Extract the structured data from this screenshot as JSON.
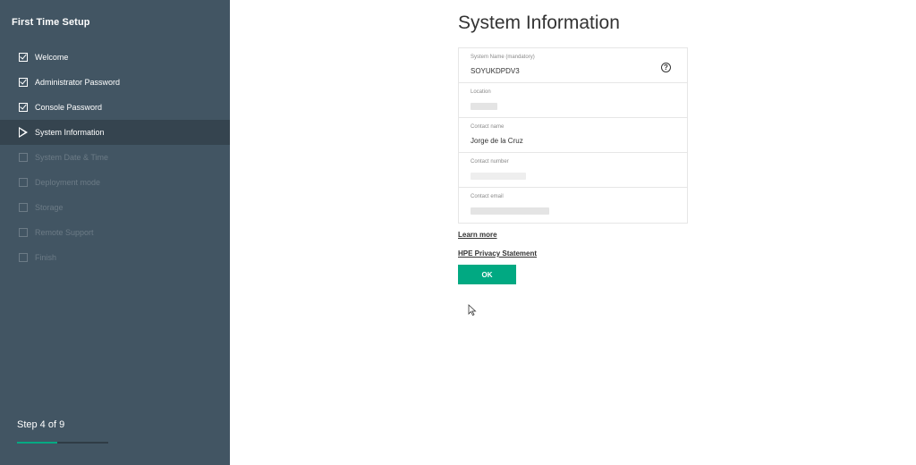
{
  "sidebar": {
    "title": "First Time Setup",
    "steps": [
      {
        "label": "Welcome",
        "state": "done"
      },
      {
        "label": "Administrator Password",
        "state": "done"
      },
      {
        "label": "Console Password",
        "state": "done"
      },
      {
        "label": "System Information",
        "state": "current"
      },
      {
        "label": "System Date & Time",
        "state": "pending"
      },
      {
        "label": "Deployment mode",
        "state": "pending"
      },
      {
        "label": "Storage",
        "state": "pending"
      },
      {
        "label": "Remote Support",
        "state": "pending"
      },
      {
        "label": "Finish",
        "state": "pending"
      }
    ],
    "step_counter": "Step 4 of 9",
    "progress": 0.44
  },
  "main": {
    "title": "System Information",
    "fields": [
      {
        "label": "System Name (mandatory)",
        "value": "SOYUKDPDV3"
      },
      {
        "label": "Location",
        "value": ""
      },
      {
        "label": "Contact name",
        "value": "Jorge de la Cruz"
      },
      {
        "label": "Contact number",
        "value": ""
      },
      {
        "label": "Contact email",
        "value": ""
      }
    ],
    "help_icon": "?",
    "learn_more": "Learn more",
    "privacy": "HPE Privacy Statement",
    "ok_label": "OK"
  },
  "colors": {
    "sidebar_bg": "#425563",
    "active_step_bg": "#35444f",
    "accent": "#01a982"
  }
}
